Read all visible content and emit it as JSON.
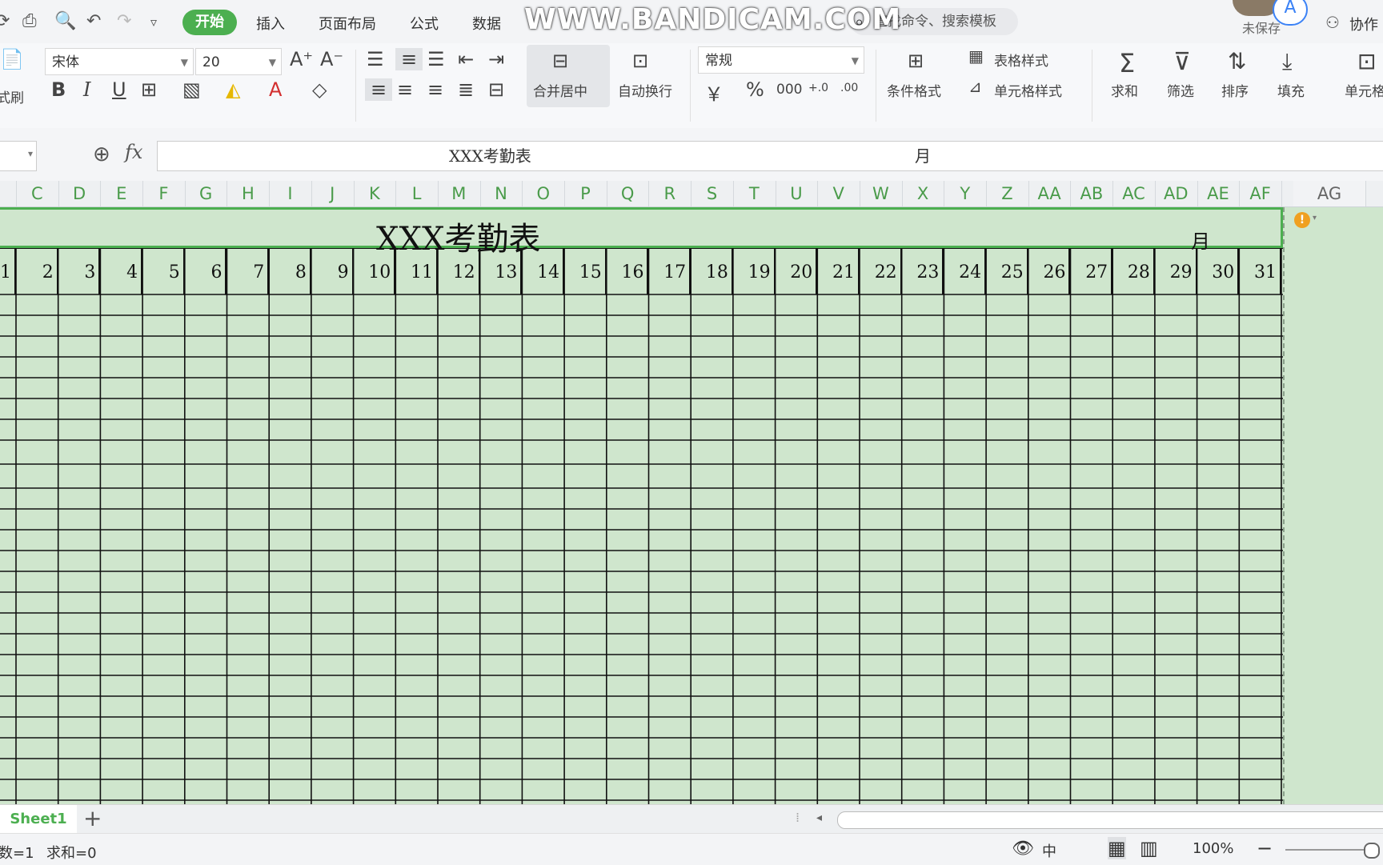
{
  "menubar": {
    "tabs": [
      "开始",
      "插入",
      "页面布局",
      "公式",
      "数据"
    ],
    "search_placeholder": "查找命令、搜索模板",
    "right_status": "未保存",
    "collab": "协作",
    "avatar_letter": "A"
  },
  "watermark": "WWW.BANDICAM.COM",
  "ribbon": {
    "format_painter": "式刷",
    "font_name": "宋体",
    "font_size": "20",
    "bold": "B",
    "italic": "I",
    "underline": "U",
    "merge_center": "合并居中",
    "wrap_text": "自动换行",
    "number_format": "常规",
    "currency": "￥",
    "percent": "%",
    "thousands": "000",
    "dec_inc": "+.0",
    "dec_dec": ".00",
    "cond_format": "条件格式",
    "table_style": "表格样式",
    "cell_style": "单元格样式",
    "sum": "求和",
    "filter": "筛选",
    "sort": "排序",
    "fill": "填充",
    "cell": "单元格"
  },
  "formula_bar": {
    "fx": "fx",
    "content_title": "XXX考勤表",
    "content_month": "月"
  },
  "columns": [
    "C",
    "D",
    "E",
    "F",
    "G",
    "H",
    "I",
    "J",
    "K",
    "L",
    "M",
    "N",
    "O",
    "P",
    "Q",
    "R",
    "S",
    "T",
    "U",
    "V",
    "W",
    "X",
    "Y",
    "Z",
    "AA",
    "AB",
    "AC",
    "AD",
    "AE",
    "AF",
    "AG"
  ],
  "sheet": {
    "title": "XXX考勤表",
    "month": "月",
    "days": [
      "1",
      "2",
      "3",
      "4",
      "5",
      "6",
      "7",
      "8",
      "9",
      "10",
      "11",
      "12",
      "13",
      "14",
      "15",
      "16",
      "17",
      "18",
      "19",
      "20",
      "21",
      "22",
      "23",
      "24",
      "25",
      "26",
      "27",
      "28",
      "29",
      "30",
      "31"
    ]
  },
  "sheet_tabs": {
    "active": "Sheet1",
    "add": "+"
  },
  "statusbar": {
    "count": "数=1",
    "sum": "求和=0",
    "input_mode": "中",
    "zoom": "100%"
  },
  "colors": {
    "accent": "#4caf50",
    "sheet_bg": "#cfe6cd",
    "column_header_text": "#4a9b4a"
  }
}
